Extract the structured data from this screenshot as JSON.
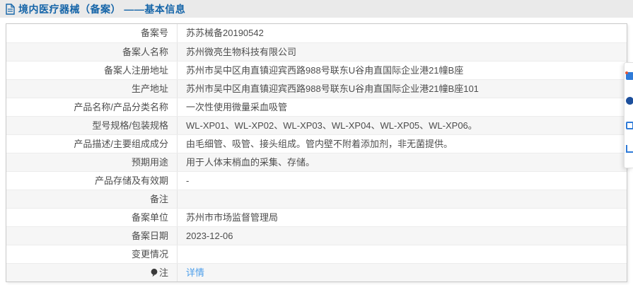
{
  "header": {
    "title": "境内医疗器械（备案） ——基本信息",
    "icon": "document-icon"
  },
  "table": {
    "rows": [
      {
        "label": "备案号",
        "value": "苏苏械备20190542"
      },
      {
        "label": "备案人名称",
        "value": "苏州微亮生物科技有限公司"
      },
      {
        "label": "备案人注册地址",
        "value": "苏州市吴中区甪直镇迎宾西路988号联东U谷甪直国际企业港21幢B座"
      },
      {
        "label": "生产地址",
        "value": "苏州市吴中区甪直镇迎宾西路988号联东U谷甪直国际企业港21幢B座101"
      },
      {
        "label": "产品名称/产品分类名称",
        "value": "一次性使用微量采血吸管"
      },
      {
        "label": "型号规格/包装规格",
        "value": "WL-XP01、WL-XP02、WL-XP03、WL-XP04、WL-XP05、WL-XP06。"
      },
      {
        "label": "产品描述/主要组成成分",
        "value": "由毛细管、吸管、接头组成。管内壁不附着添加剂，非无菌提供。"
      },
      {
        "label": "预期用途",
        "value": "用于人体末梢血的采集、存储。"
      },
      {
        "label": "产品存储及有效期",
        "value": "-"
      },
      {
        "label": "备注",
        "value": ""
      },
      {
        "label": "备案单位",
        "value": "苏州市市场监督管理局"
      },
      {
        "label": "备案日期",
        "value": "2023-12-06"
      },
      {
        "label": "变更情况",
        "value": ""
      },
      {
        "label": "注",
        "label_icon": "pin-icon",
        "value": "详情",
        "value_link": true
      }
    ]
  },
  "floating_widget": {
    "icons": [
      "toolbar-icon-chat",
      "toolbar-icon-qq",
      "toolbar-icon-share",
      "toolbar-icon-link"
    ]
  },
  "colors": {
    "title_blue": "#1464a8",
    "link_blue": "#4c9eea",
    "header_strip": "#eaeaea",
    "row_alt": "#f6f6f6",
    "border": "#c9c9c9",
    "text": "#4d4d4d"
  }
}
